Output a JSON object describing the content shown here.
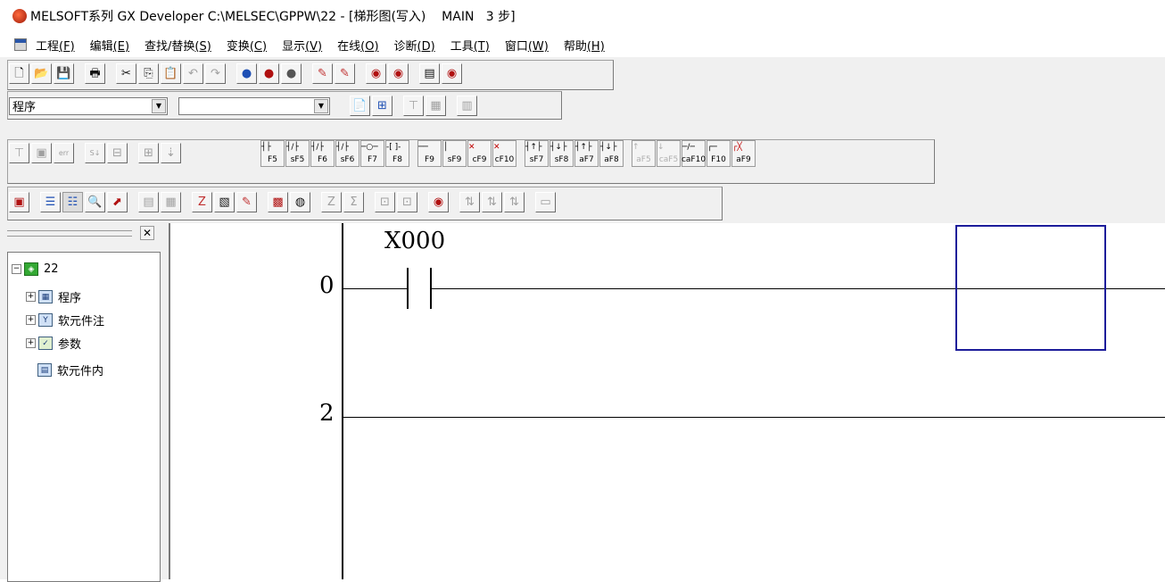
{
  "window": {
    "title": "MELSOFT系列 GX Developer C:\\MELSEC\\GPPW\\22 - [梯形图(写入)    MAIN   3 步]"
  },
  "menu": {
    "items": [
      {
        "label": "工程",
        "key": "(F)"
      },
      {
        "label": "编辑",
        "key": "(E)"
      },
      {
        "label": "查找/替换",
        "key": "(S)"
      },
      {
        "label": "变换",
        "key": "(C)"
      },
      {
        "label": "显示",
        "key": "(V)"
      },
      {
        "label": "在线",
        "key": "(O)"
      },
      {
        "label": "诊断",
        "key": "(D)"
      },
      {
        "label": "工具",
        "key": "(T)"
      },
      {
        "label": "窗口",
        "key": "(W)"
      },
      {
        "label": "帮助",
        "key": "(H)"
      }
    ]
  },
  "toolbar2": {
    "combo1_value": "程序",
    "combo2_value": ""
  },
  "ladder_keys": [
    {
      "sym": "┤├",
      "key": "F5"
    },
    {
      "sym": "┤/├",
      "key": "sF5"
    },
    {
      "sym": "┤/├",
      "key": "F6"
    },
    {
      "sym": "┤/├",
      "key": "sF6"
    },
    {
      "sym": "─○─",
      "key": "F7"
    },
    {
      "sym": "-[ ]-",
      "key": "F8"
    },
    {
      "sym": "──",
      "key": "F9"
    },
    {
      "sym": "│",
      "key": "sF9"
    },
    {
      "sym": "✕",
      "key": "cF9"
    },
    {
      "sym": "✕",
      "key": "cF10"
    },
    {
      "sym": "┤↑├",
      "key": "sF7"
    },
    {
      "sym": "┤↓├",
      "key": "sF8"
    },
    {
      "sym": "┤↑├",
      "key": "aF7"
    },
    {
      "sym": "┤↓├",
      "key": "aF8"
    },
    {
      "sym": "↑",
      "key": "aF5"
    },
    {
      "sym": "↓",
      "key": "caF5"
    },
    {
      "sym": "─/─",
      "key": "caF10"
    },
    {
      "sym": "┌─",
      "key": "F10"
    },
    {
      "sym": "┌╳",
      "key": "aF9"
    }
  ],
  "tree": {
    "root": "22",
    "items": [
      "程序",
      "软元件注",
      "参数",
      "软元件内"
    ]
  },
  "ladder": {
    "step0": "0",
    "step1": "2",
    "contact_device": "X000"
  }
}
